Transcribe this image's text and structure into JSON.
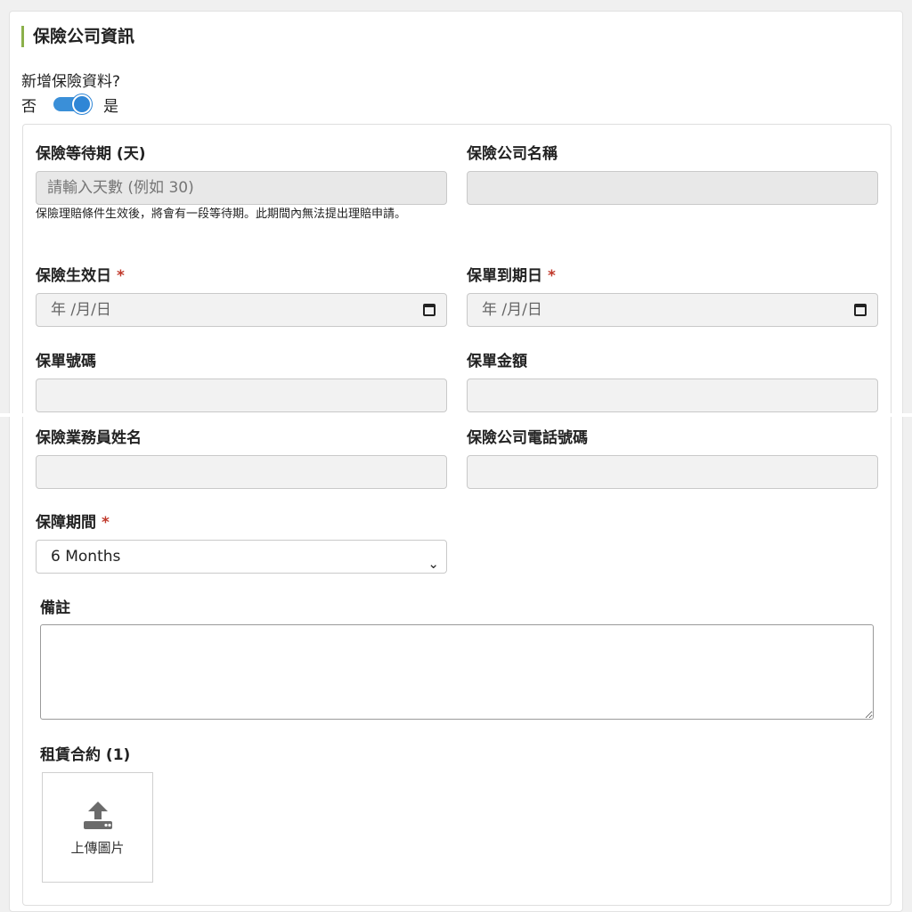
{
  "section": {
    "title": "保險公司資訊"
  },
  "toggle": {
    "question": "新增保險資料?",
    "off_label": "否",
    "on_label": "是",
    "state": "on"
  },
  "form": {
    "waiting_period": {
      "label": "保險等待期 (天)",
      "placeholder": "請輸入天數 (例如 30)",
      "help": "保險理賠條件生效後，將會有一段等待期。此期間內無法提出理賠申請。"
    },
    "company_name": {
      "label": "保險公司名稱",
      "value": ""
    },
    "effective_date": {
      "label": "保險生效日",
      "required_mark": "*",
      "placeholder": "年 /月/日"
    },
    "expiry_date": {
      "label": "保單到期日",
      "required_mark": "*",
      "placeholder": "年 /月/日"
    },
    "policy_number": {
      "label": "保單號碼",
      "value": ""
    },
    "policy_amount": {
      "label": "保單金額",
      "value": ""
    },
    "agent_name": {
      "label": "保險業務員姓名",
      "value": ""
    },
    "company_phone": {
      "label": "保險公司電話號碼",
      "value": ""
    },
    "coverage_period": {
      "label": "保障期間",
      "required_mark": "*",
      "selected": "6 Months"
    },
    "notes": {
      "label": "備註",
      "value": ""
    },
    "lease": {
      "label": "租賃合約 (1)",
      "upload_label": "上傳圖片"
    }
  },
  "icons": {
    "calendar": "calendar-icon",
    "chevron": "chevron-down-icon",
    "upload": "upload-icon"
  },
  "colors": {
    "accent_bar": "#8bb04a",
    "toggle_on": "#2f86d6",
    "required": "#c0392b"
  }
}
